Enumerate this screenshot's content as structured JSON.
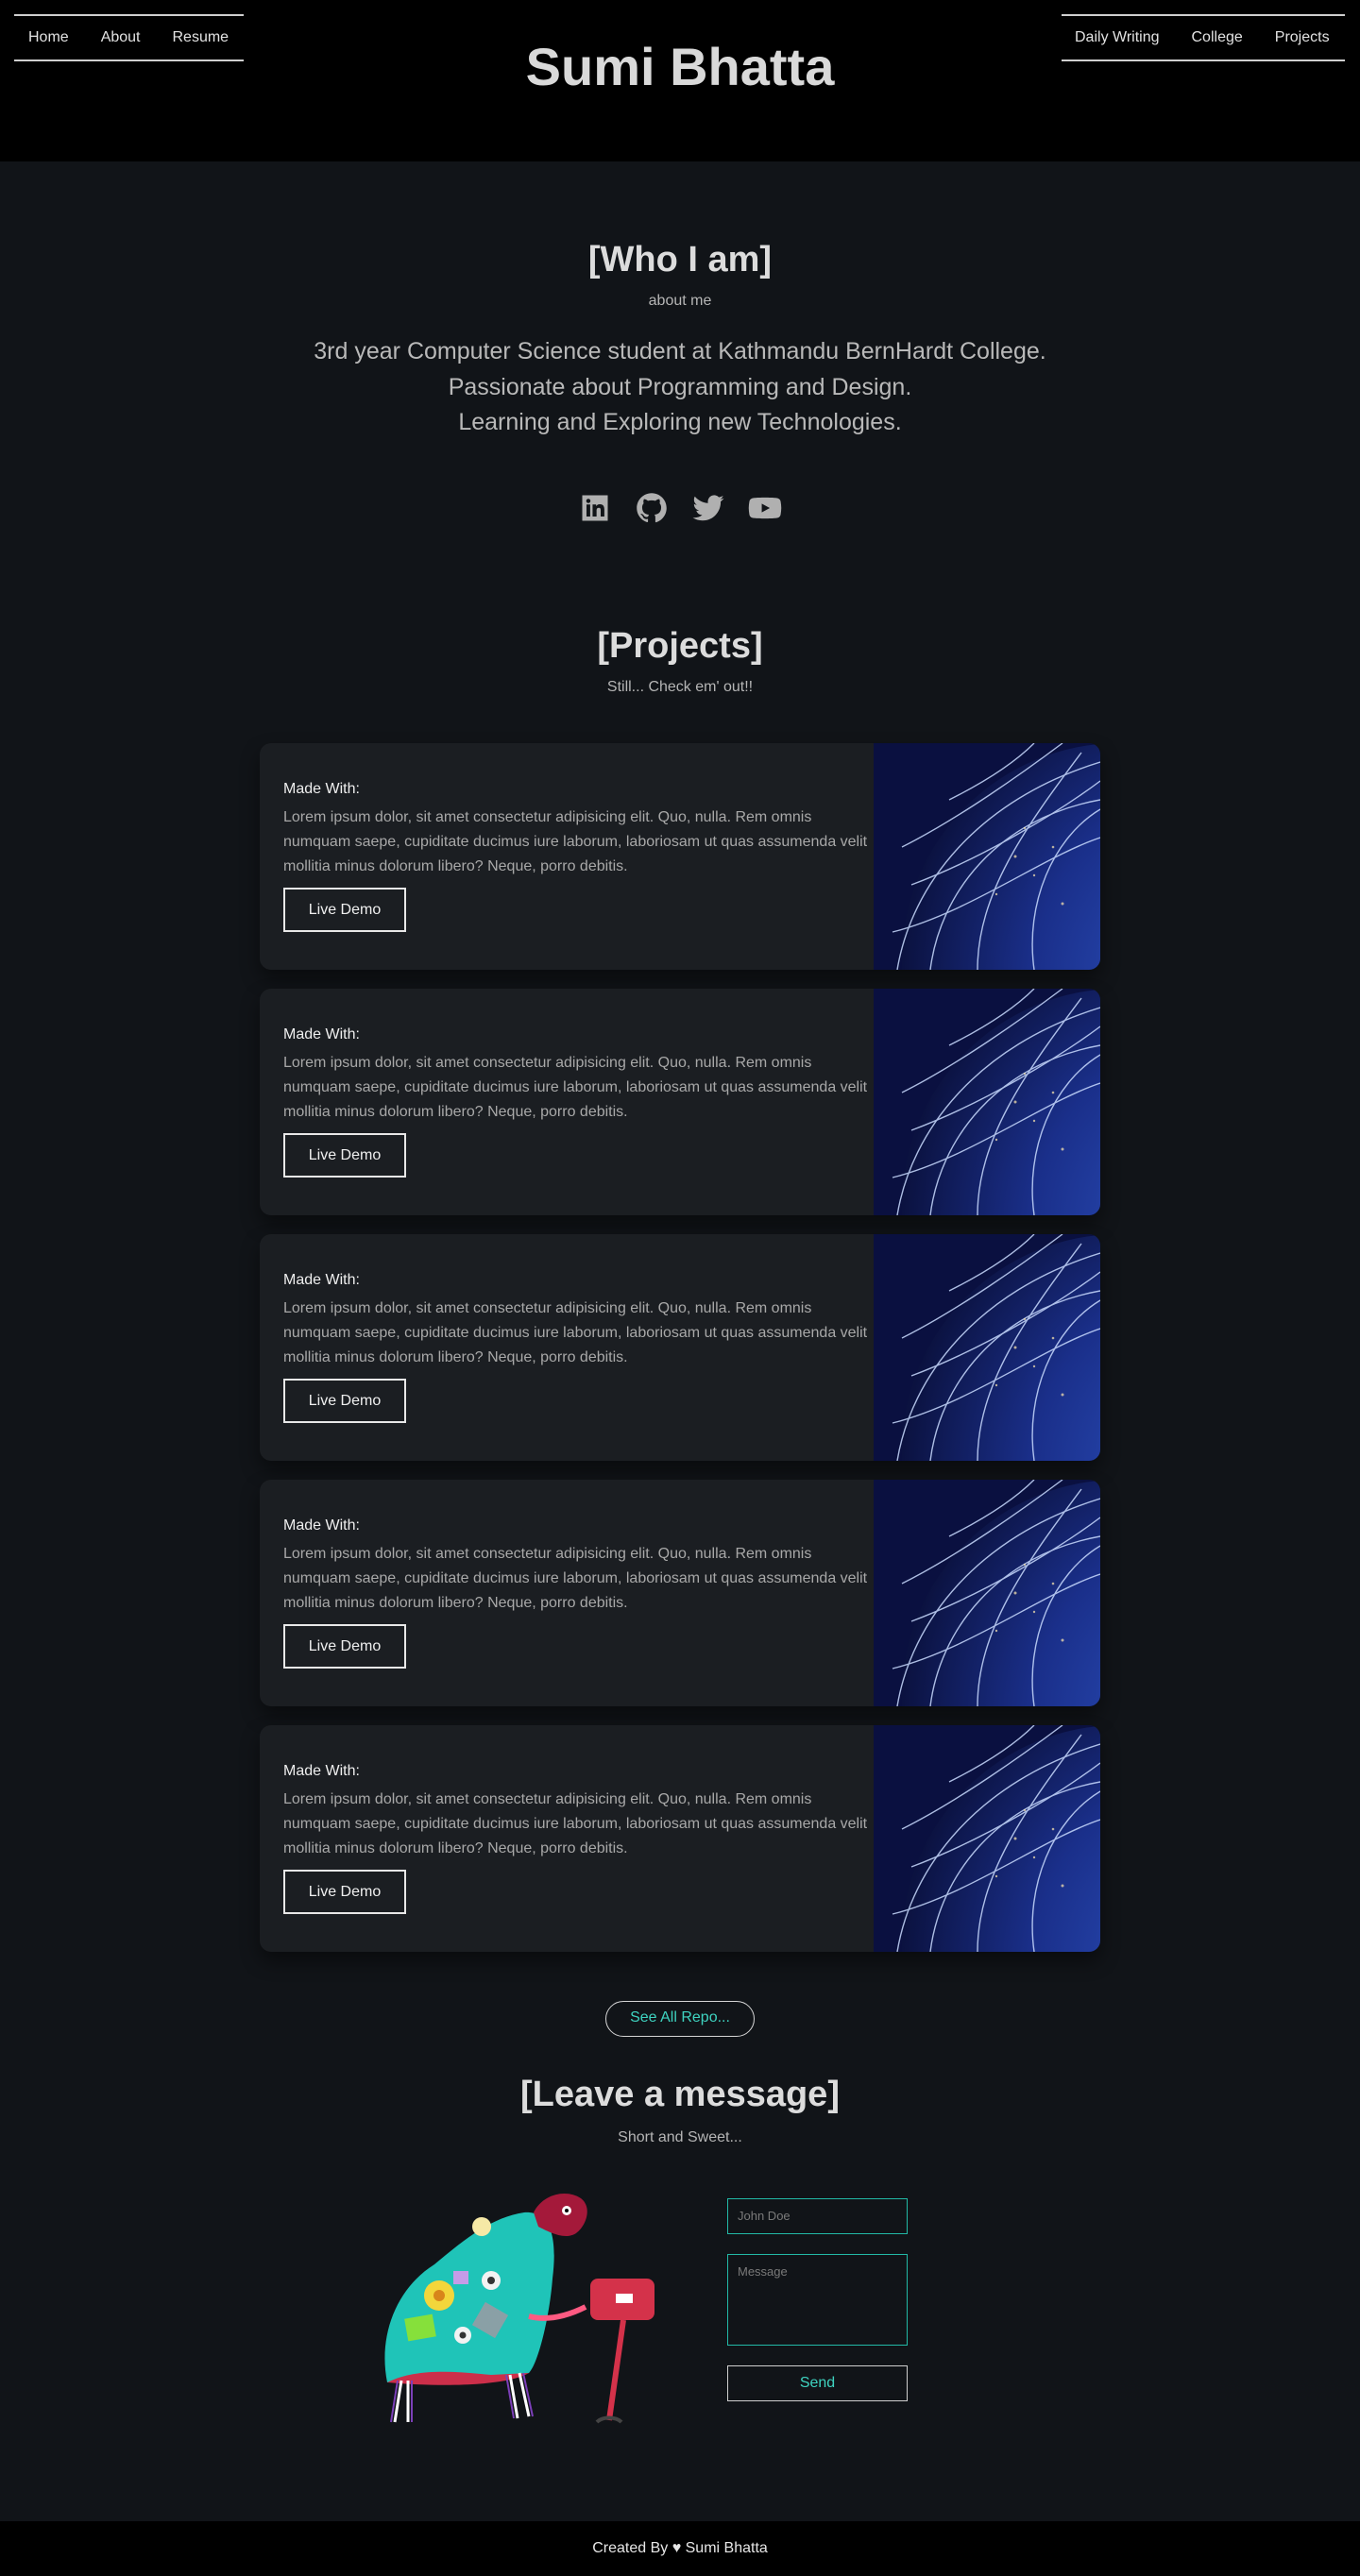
{
  "header": {
    "title": "Sumi Bhatta",
    "nav_left": [
      "Home",
      "About",
      "Resume"
    ],
    "nav_right": [
      "Daily Writing",
      "College",
      "Projects"
    ]
  },
  "about": {
    "title": "[Who I am]",
    "subtitle": "about me",
    "bio": [
      "3rd year Computer Science student at Kathmandu BernHardt College.",
      "Passionate about Programming and Design.",
      "Learning and Exploring new Technologies."
    ],
    "socials": [
      "linkedin-icon",
      "github-icon",
      "twitter-icon",
      "youtube-icon"
    ]
  },
  "projects": {
    "title": "[Projects]",
    "subtitle": "Still... Check em' out!!",
    "cards": [
      {
        "made_with": "Made With:",
        "description": "Lorem ipsum dolor, sit amet consectetur adipisicing elit. Quo, nulla. Rem omnis numquam saepe, cupiditate ducimus iure laborum, laboriosam ut quas assumenda velit mollitia minus dolorum libero? Neque, porro debitis.",
        "button": "Live Demo"
      },
      {
        "made_with": "Made With:",
        "description": "Lorem ipsum dolor, sit amet consectetur adipisicing elit. Quo, nulla. Rem omnis numquam saepe, cupiditate ducimus iure laborum, laboriosam ut quas assumenda velit mollitia minus dolorum libero? Neque, porro debitis.",
        "button": "Live Demo"
      },
      {
        "made_with": "Made With:",
        "description": "Lorem ipsum dolor, sit amet consectetur adipisicing elit. Quo, nulla. Rem omnis numquam saepe, cupiditate ducimus iure laborum, laboriosam ut quas assumenda velit mollitia minus dolorum libero? Neque, porro debitis.",
        "button": "Live Demo"
      },
      {
        "made_with": "Made With:",
        "description": "Lorem ipsum dolor, sit amet consectetur adipisicing elit. Quo, nulla. Rem omnis numquam saepe, cupiditate ducimus iure laborum, laboriosam ut quas assumenda velit mollitia minus dolorum libero? Neque, porro debitis.",
        "button": "Live Demo"
      },
      {
        "made_with": "Made With:",
        "description": "Lorem ipsum dolor, sit amet consectetur adipisicing elit. Quo, nulla. Rem omnis numquam saepe, cupiditate ducimus iure laborum, laboriosam ut quas assumenda velit mollitia minus dolorum libero? Neque, porro debitis.",
        "button": "Live Demo"
      }
    ],
    "repo_button": "See All Repo..."
  },
  "contact": {
    "title": "[Leave a message]",
    "subtitle": "Short and Sweet...",
    "name_placeholder": "John Doe",
    "message_placeholder": "Message",
    "send_label": "Send"
  },
  "footer": {
    "text": "Created By ♥ Sumi Bhatta"
  },
  "colors": {
    "accent": "#3ed3c0",
    "input_border": "#22b9a6",
    "card_bg": "#1b1e22",
    "header_bg": "#000000"
  }
}
